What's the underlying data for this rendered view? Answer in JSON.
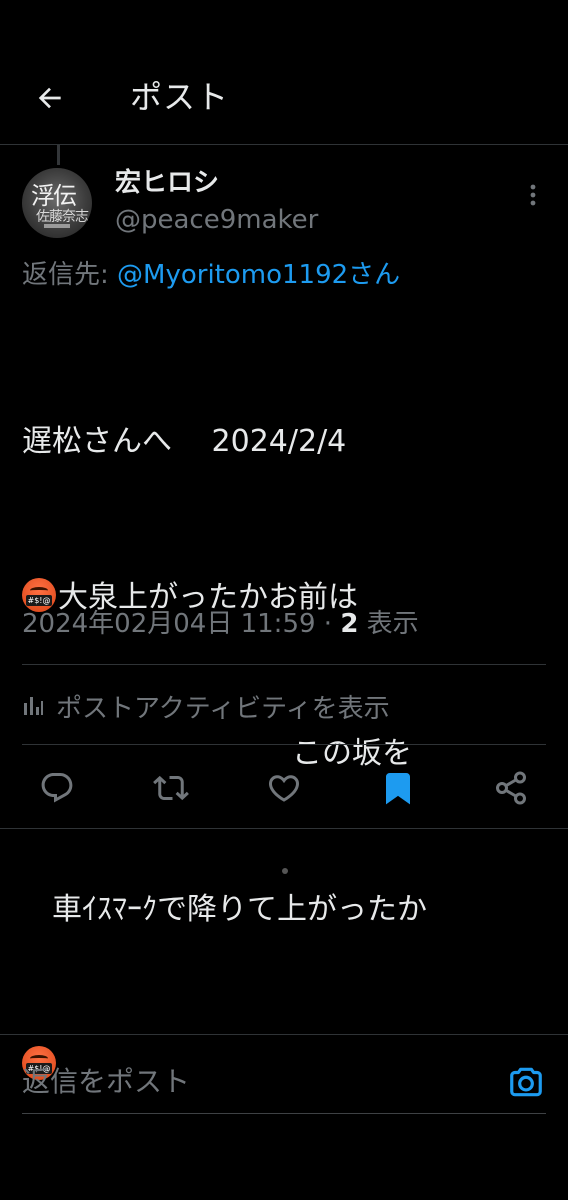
{
  "header": {
    "title": "ポスト"
  },
  "author": {
    "display_name": "宏ヒロシ",
    "handle": "@peace9maker",
    "avatar_text_1": "浮伝",
    "avatar_text_2": "佐藤奈志"
  },
  "reply": {
    "prefix": "返信先: ",
    "mention": "@Myoritomo1192さん"
  },
  "post": {
    "lines": [
      "遅松さんへ　 2024/2/4",
      "大泉上がったかお前は",
      "　　　　　　　　　この坂を",
      "　車ｲｽﾏｰｸで降りて上がったか",
      ""
    ],
    "emoji": "🤬"
  },
  "meta": {
    "timestamp": "2024年02月04日 11:59 · ",
    "views_count": "2",
    "views_label": " 表示"
  },
  "activity": {
    "label": "ポストアクティビティを表示"
  },
  "actions": [
    {
      "name": "reply",
      "icon": "reply-icon"
    },
    {
      "name": "repost",
      "icon": "repost-icon"
    },
    {
      "name": "like",
      "icon": "heart-icon"
    },
    {
      "name": "bookmark",
      "icon": "bookmark-icon",
      "active": true
    },
    {
      "name": "share",
      "icon": "share-icon"
    }
  ],
  "composer": {
    "placeholder": "返信をポスト"
  },
  "colors": {
    "accent": "#1d9bf0",
    "background": "#000000",
    "muted": "#71767b",
    "text": "#e7e9ea"
  }
}
